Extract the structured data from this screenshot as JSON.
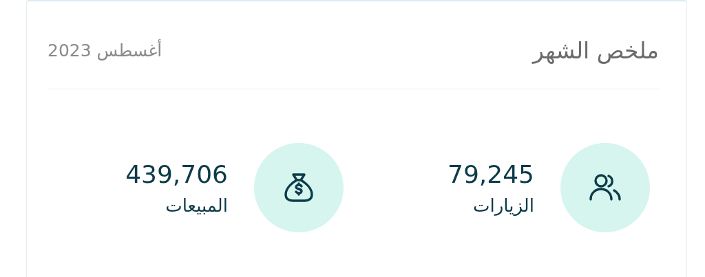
{
  "card": {
    "title": "ملخص الشهر",
    "period": "أغسطس 2023"
  },
  "stats": [
    {
      "kind": "visits",
      "value": "79,245",
      "label": "الزيارات"
    },
    {
      "kind": "sales",
      "value": "439,706",
      "label": "المبيعات"
    }
  ]
}
